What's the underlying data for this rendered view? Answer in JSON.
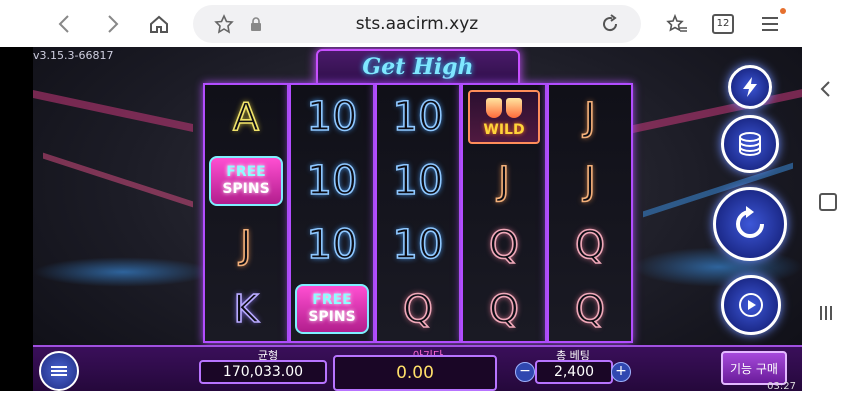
{
  "browser": {
    "url": "sts.aacirm.xyz",
    "tab_count": "12",
    "icons": [
      "back-icon",
      "forward-icon",
      "home-icon",
      "star-icon",
      "lock-icon",
      "reload-icon",
      "favorites-icon",
      "tabs-icon",
      "menu-icon"
    ]
  },
  "game": {
    "version": "v3.15.3-66817",
    "logo_text": "Get High",
    "reels": [
      [
        "A",
        "FREE SPINS",
        "J",
        "K"
      ],
      [
        "10",
        "10",
        "10",
        "FREE SPINS"
      ],
      [
        "10",
        "10",
        "10",
        "Q"
      ],
      [
        "WILD",
        "J",
        "Q",
        "Q"
      ],
      [
        "J",
        "J",
        "Q",
        "Q"
      ]
    ],
    "free_spins": {
      "top": "FREE",
      "bottom": "SPINS"
    },
    "wild_label": "WILD",
    "side_buttons": [
      "turbo-button",
      "coins-button",
      "spin-button",
      "autoplay-button"
    ],
    "balance": {
      "label": "균형",
      "value": "170,033.00"
    },
    "win": {
      "label": "아기다",
      "value": "0.00"
    },
    "bet": {
      "label": "총 베팅",
      "value": "2,400",
      "minus": "−",
      "plus": "+"
    },
    "buy_feature": "기능 구매",
    "clock": "03:27"
  },
  "colors": {
    "reel_border": "#b24dff",
    "ten": "#8fc8ff",
    "free_bg": "#ff4fd2",
    "bar_bg": "#3a0f5a"
  }
}
